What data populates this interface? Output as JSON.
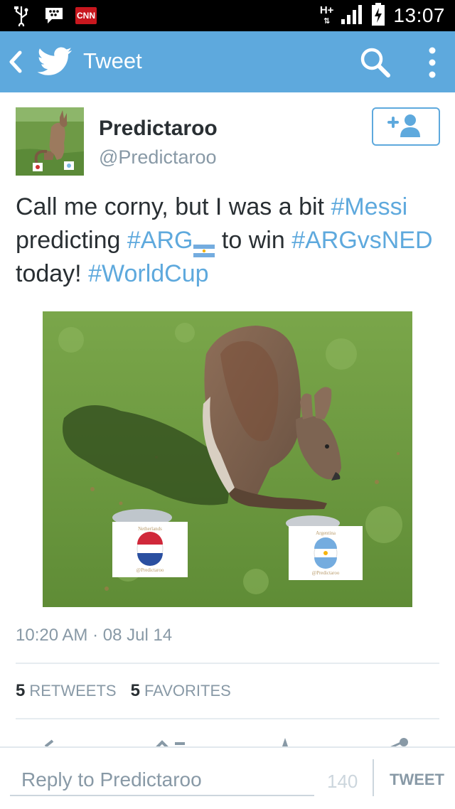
{
  "status_bar": {
    "notification_icons": [
      "usb-icon",
      "blackberry-messenger-icon",
      "cnn-icon"
    ],
    "cnn_label": "CNN",
    "network_label": "H+",
    "time": "13:07"
  },
  "action_bar": {
    "title": "Tweet",
    "icons": [
      "back-chevron-icon",
      "twitter-bird-icon",
      "search-icon",
      "overflow-menu-icon"
    ],
    "background_color": "#5ea9dd"
  },
  "tweet": {
    "author": {
      "display_name": "Predictaroo",
      "handle": "@Predictaroo"
    },
    "text_segments": [
      {
        "type": "text",
        "value": "Call me corny, but I was a bit "
      },
      {
        "type": "hashtag",
        "value": "#Messi"
      },
      {
        "type": "text",
        "value": " predicting "
      },
      {
        "type": "hashtag",
        "value": "#ARG"
      },
      {
        "type": "text",
        "value": " to win "
      },
      {
        "type": "hashtag",
        "value": "#ARGvsNED"
      },
      {
        "type": "text",
        "value": " today! "
      },
      {
        "type": "hashtag",
        "value": "#WorldCup"
      }
    ],
    "photo": {
      "sign_left": {
        "country": "Netherlands",
        "credit": "@Predictaroo"
      },
      "sign_right": {
        "country": "Argentina",
        "credit": "@Predictaroo"
      }
    },
    "timestamp": "10:20 AM · 08 Jul 14",
    "retweets": {
      "count": "5",
      "label": "RETWEETS"
    },
    "favorites": {
      "count": "5",
      "label": "FAVORITES"
    },
    "accent_color": "#5ea9dd"
  },
  "reply_bar": {
    "placeholder": "Reply to Predictaroo",
    "char_count": "140",
    "tweet_button": "TWEET"
  }
}
